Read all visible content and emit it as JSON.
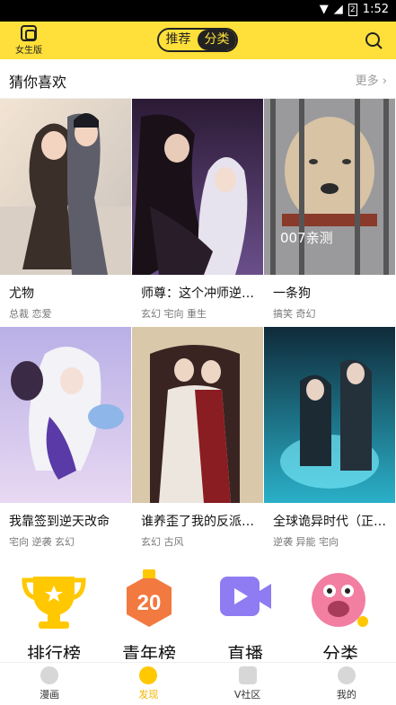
{
  "status_bar": {
    "time": "1:52",
    "battery": "2"
  },
  "top_bar": {
    "female_label": "女生版",
    "segments": [
      "推荐",
      "分类"
    ],
    "selected_segment": "推荐"
  },
  "section": {
    "title": "猜你喜欢",
    "more_label": "更多"
  },
  "comics": [
    {
      "title": "尤物",
      "tags": "总裁 恋爱",
      "cover_text": ""
    },
    {
      "title": "师尊：这个冲师逆…",
      "tags": "玄幻 宅向 重生",
      "cover_text": ""
    },
    {
      "title": "一条狗",
      "tags": "搞笑 奇幻",
      "cover_text": "007亲测"
    },
    {
      "title": "我靠签到逆天改命",
      "tags": "宅向 逆袭 玄幻",
      "cover_text": ""
    },
    {
      "title": "谁养歪了我的反派…",
      "tags": "玄幻 古风",
      "cover_text": ""
    },
    {
      "title": "全球诡异时代（正…",
      "tags": "逆袭 异能 宅向",
      "cover_text": ""
    }
  ],
  "entries": [
    {
      "label": "排行榜",
      "icon": "trophy-icon"
    },
    {
      "label": "青年榜",
      "icon": "youth-badge-icon",
      "badge": "20"
    },
    {
      "label": "直播",
      "icon": "video-icon"
    },
    {
      "label": "分类",
      "icon": "category-face-icon"
    }
  ],
  "tabs": [
    {
      "label": "漫画",
      "active": false
    },
    {
      "label": "发现",
      "active": true
    },
    {
      "label": "V社区",
      "active": false
    },
    {
      "label": "我的",
      "active": false
    }
  ],
  "colors": {
    "accent": "#ffe03a",
    "active_tab": "#f4b400"
  }
}
